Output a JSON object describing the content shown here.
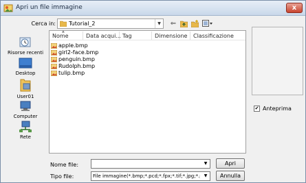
{
  "window": {
    "title": "Apri un file immagine",
    "close_glyph": "x"
  },
  "lookin": {
    "label": "Cerca in:",
    "value": "Tutorial_2"
  },
  "places": [
    {
      "label": "Risorse recenti",
      "icon": "recent-icon"
    },
    {
      "label": "Desktop",
      "icon": "desktop-icon"
    },
    {
      "label": "User01",
      "icon": "user-folder-icon"
    },
    {
      "label": "Computer",
      "icon": "computer-icon"
    },
    {
      "label": "Rete",
      "icon": "network-icon"
    }
  ],
  "columns": [
    "Nome",
    "Data acqui...",
    "Tag",
    "Dimensione",
    "Classificazione"
  ],
  "files": [
    "apple.bmp",
    "girl2-face.bmp",
    "penguin.bmp",
    "Rudolph.bmp",
    "tulip.bmp"
  ],
  "preview": {
    "checkbox_label": "Anteprima",
    "checked": true,
    "check_glyph": "✔"
  },
  "filename": {
    "label": "Nome file:",
    "value": ""
  },
  "filetype": {
    "label": "Tipo file:",
    "value": "File immagine(*.bmp;*.pcd;*.fpx;*.tif;*.jpg;*.pcx;*.wmf;*"
  },
  "buttons": {
    "open": "Apri",
    "cancel": "Annulla"
  },
  "colors": {
    "accent": "#c8442f",
    "folder": "#e8b84a"
  }
}
